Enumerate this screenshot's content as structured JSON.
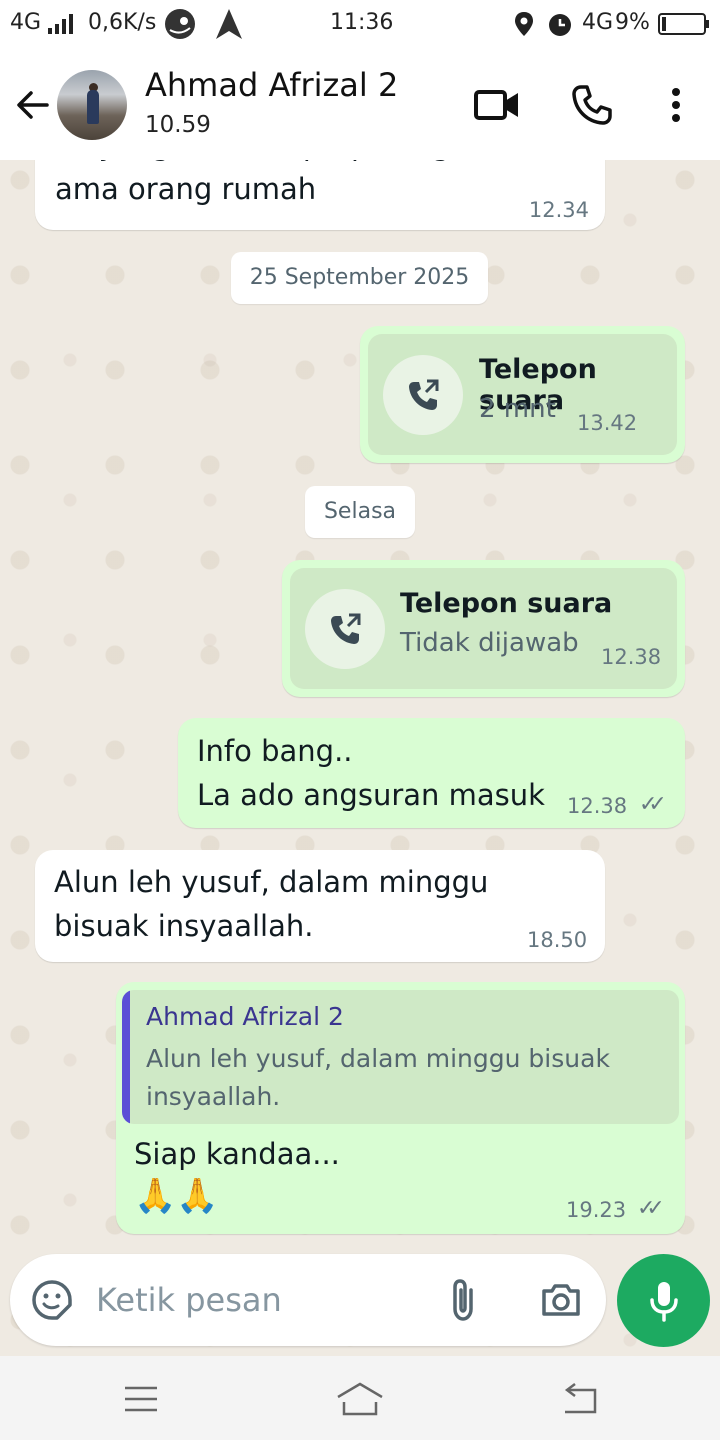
{
  "status_bar": {
    "network_left": "4G",
    "speed": "0,6K/s",
    "time": "11:36",
    "network_right": "4G",
    "battery": "9%"
  },
  "header": {
    "contact_name": "Ahmad Afrizal 2",
    "contact_status": "10.59"
  },
  "messages": {
    "m1": {
      "text": "ini yang bulan sept, pulang ari ti\nama orang rumah",
      "time": "12.34"
    },
    "date1": "25 September 2025",
    "call1": {
      "title": "Telepon suara",
      "subtitle": "2 mnt",
      "time": "13.42"
    },
    "date2": "Selasa",
    "call2": {
      "title": "Telepon suara",
      "subtitle": "Tidak dijawab",
      "time": "12.38"
    },
    "m2": {
      "text": "Info bang..\nLa ado angsuran masuk",
      "time": "12.38"
    },
    "m3": {
      "text": "Alun leh yusuf, dalam minggu\nbisuak insyaallah.",
      "time": "18.50"
    },
    "m4": {
      "quote_name": "Ahmad Afrizal 2",
      "quote_text": "Alun leh yusuf, dalam minggu bisuak insyaallah.",
      "text": "Siap kandaa...",
      "emoji": "🙏🙏",
      "time": "19.23"
    }
  },
  "composer": {
    "placeholder": "Ketik pesan"
  },
  "colors": {
    "incoming_bubble": "#ffffff",
    "outgoing_bubble": "#d9fdd3",
    "accent_green": "#1daa61",
    "chat_background": "#efeae2",
    "read_ticks": "#667781"
  },
  "icons": {
    "back": "back-arrow-icon",
    "video": "video-call-icon",
    "voice": "phone-icon",
    "menu": "more-vert-icon",
    "sticker": "sticker-icon",
    "attach": "paperclip-icon",
    "camera": "camera-icon",
    "mic": "mic-icon"
  }
}
